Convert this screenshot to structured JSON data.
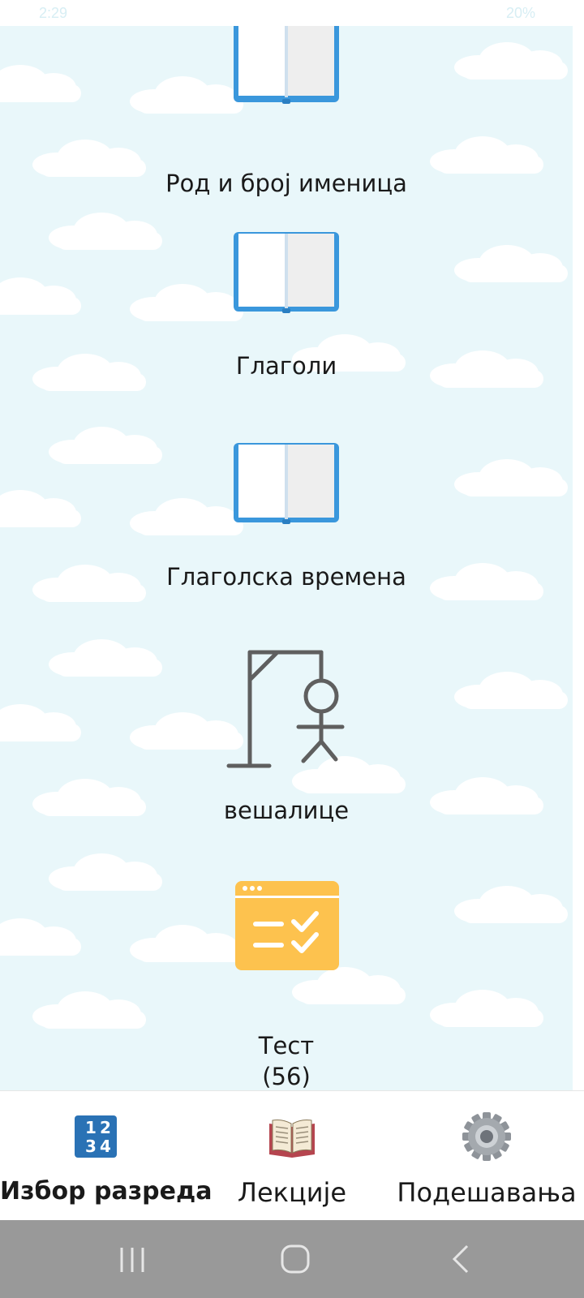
{
  "status_bar": {
    "time": "2:29",
    "battery": "20%"
  },
  "items": [
    {
      "label": "Род и број именица",
      "icon": "book-icon"
    },
    {
      "label": "Глаголи",
      "icon": "book-icon"
    },
    {
      "label": "Глаголска времена",
      "icon": "book-icon"
    },
    {
      "label": "вешалице",
      "icon": "hangman-icon"
    },
    {
      "label": "Тест",
      "count": "(56)",
      "icon": "quiz-checklist-icon"
    }
  ],
  "bottom_nav": [
    {
      "label": "Избор разреда",
      "icon": "number-grid-icon",
      "active": true,
      "icon_digits": [
        "1",
        "2",
        "3",
        "4"
      ]
    },
    {
      "label": "Лекције",
      "icon": "open-book-icon",
      "active": false
    },
    {
      "label": "Подешавања",
      "icon": "gear-icon",
      "active": false
    }
  ],
  "colors": {
    "background": "#e9f7fa",
    "book_blue": "#3a97dc",
    "quiz_yellow": "#fdc24e",
    "hangman_gray": "#5f5f5f",
    "number_grid_blue": "#2a72b5"
  }
}
